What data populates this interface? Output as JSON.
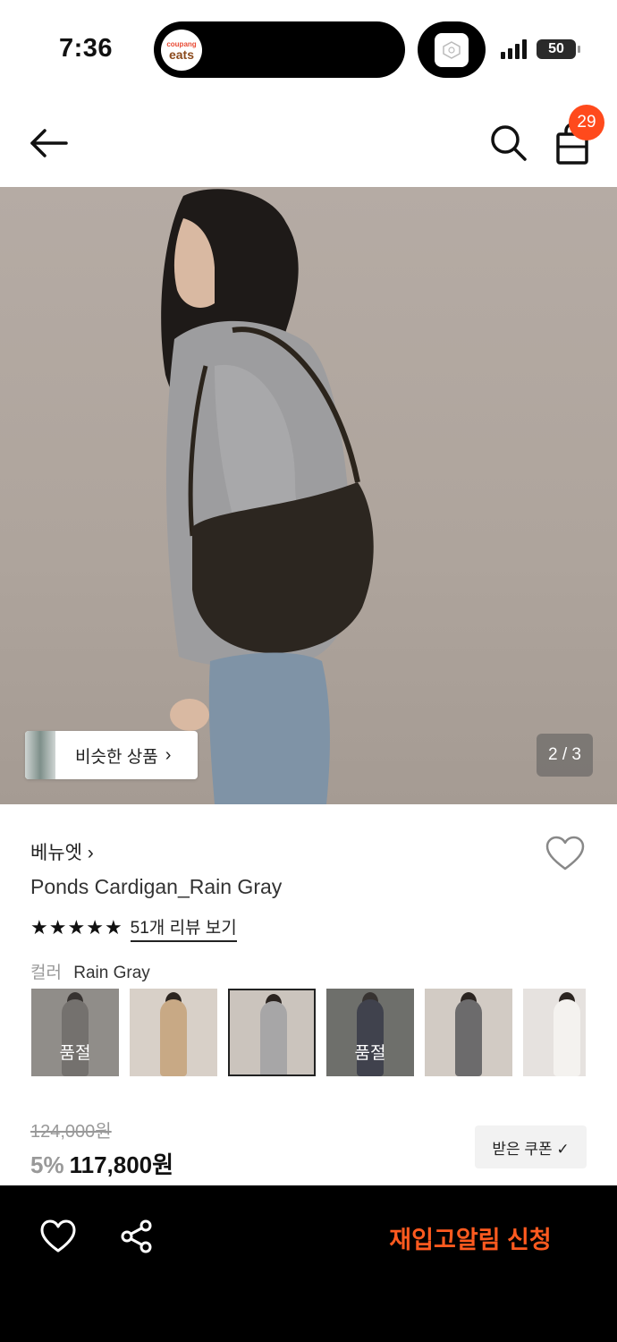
{
  "status_bar": {
    "time": "7:36",
    "app_small": "coupang",
    "app_big": "eats",
    "battery": "50"
  },
  "nav": {
    "cart_count": "29",
    "back_icon": "arrow-left-icon",
    "search_icon": "search-icon",
    "cart_icon": "shopping-bag-icon"
  },
  "hero": {
    "similar_label": "비슷한 상품",
    "similar_chevron": "›",
    "page_indicator": "2 / 3"
  },
  "product": {
    "brand": "베뉴엣 ›",
    "title": "Ponds Cardigan_Rain Gray",
    "stars": [
      "★",
      "★",
      "★",
      "★",
      "★"
    ],
    "review_link": "51개 리뷰 보기",
    "color_label": "컬러",
    "color_value": "Rain Gray",
    "swatches": [
      {
        "sold_label": "품절",
        "sold_out": true,
        "selected": false
      },
      {
        "sold_label": "",
        "sold_out": false,
        "selected": false
      },
      {
        "sold_label": "",
        "sold_out": false,
        "selected": true
      },
      {
        "sold_label": "품절",
        "sold_out": true,
        "selected": false
      },
      {
        "sold_label": "",
        "sold_out": false,
        "selected": false
      },
      {
        "sold_label": "",
        "sold_out": false,
        "selected": false
      }
    ]
  },
  "price": {
    "original": "124,000원",
    "discount": "5%",
    "final": "117,800원",
    "coupon_label": "받은 쿠폰 ✓"
  },
  "bottom_bar": {
    "restock_label": "재입고알림 신청",
    "heart_icon": "heart-outline-icon",
    "share_icon": "share-icon"
  },
  "colors": {
    "accent": "#ff5a1f",
    "badge": "#ff4a1c"
  }
}
